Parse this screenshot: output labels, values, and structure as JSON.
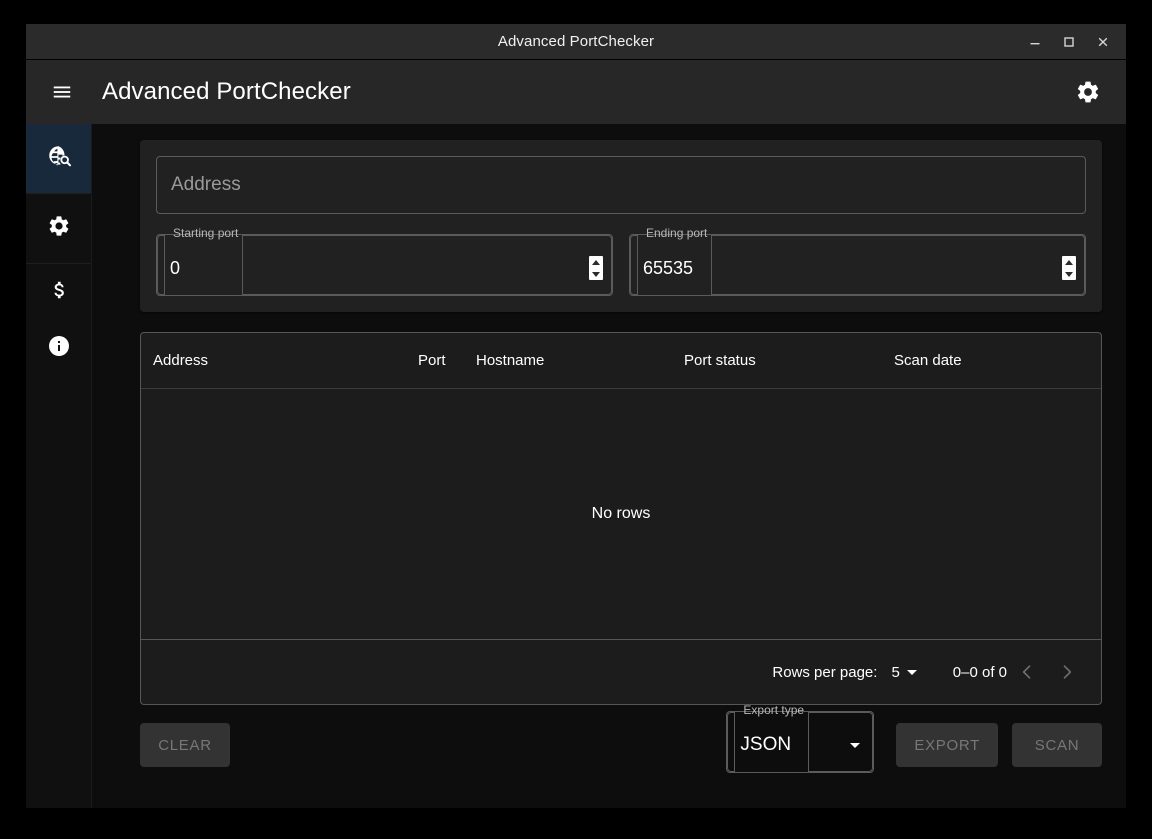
{
  "window": {
    "title": "Advanced PortChecker",
    "controls": [
      {
        "name": "minimize-button",
        "glyph": "minimize"
      },
      {
        "name": "maximize-button",
        "glyph": "maximize"
      },
      {
        "name": "close-button",
        "glyph": "close"
      }
    ]
  },
  "appbar": {
    "menu_icon": "hamburger-menu-icon",
    "title": "Advanced PortChecker",
    "settings_icon": "gear-icon"
  },
  "sidebar": {
    "items": [
      {
        "icon": "travel-explore-icon",
        "name": "sidebar-item-port-scan",
        "active": true
      },
      {
        "icon": "gear-icon",
        "name": "sidebar-item-settings",
        "active": false
      },
      {
        "icon": "dollar-icon",
        "name": "sidebar-item-donate",
        "active": false
      },
      {
        "icon": "info-icon",
        "name": "sidebar-item-about",
        "active": false
      }
    ]
  },
  "form": {
    "address": {
      "label": "Address",
      "placeholder": "Address",
      "value": ""
    },
    "starting_port": {
      "label": "Starting port",
      "value": "0"
    },
    "ending_port": {
      "label": "Ending port",
      "value": "65535"
    }
  },
  "table": {
    "columns": [
      "Address",
      "Port",
      "Hostname",
      "Port status",
      "Scan date"
    ],
    "rows": [],
    "empty_text": "No rows",
    "pagination": {
      "rows_per_page_label": "Rows per page:",
      "rows_per_page_value": "5",
      "range_text": "0–0 of 0",
      "prev_label": "previous-page",
      "next_label": "next-page"
    }
  },
  "actions": {
    "clear_label": "CLEAR",
    "export_type_label": "Export type",
    "export_type_value": "JSON",
    "export_label": "EXPORT",
    "scan_label": "SCAN"
  },
  "colors": {
    "page_background": "#0d0d0d",
    "card_background": "#212121",
    "appbar_background": "#272727",
    "titlebar_background": "#2b2b2b",
    "rail_active": "#17293a",
    "disabled_button": "#333333",
    "disabled_text": "#777777",
    "border": "#5b5b5b"
  }
}
